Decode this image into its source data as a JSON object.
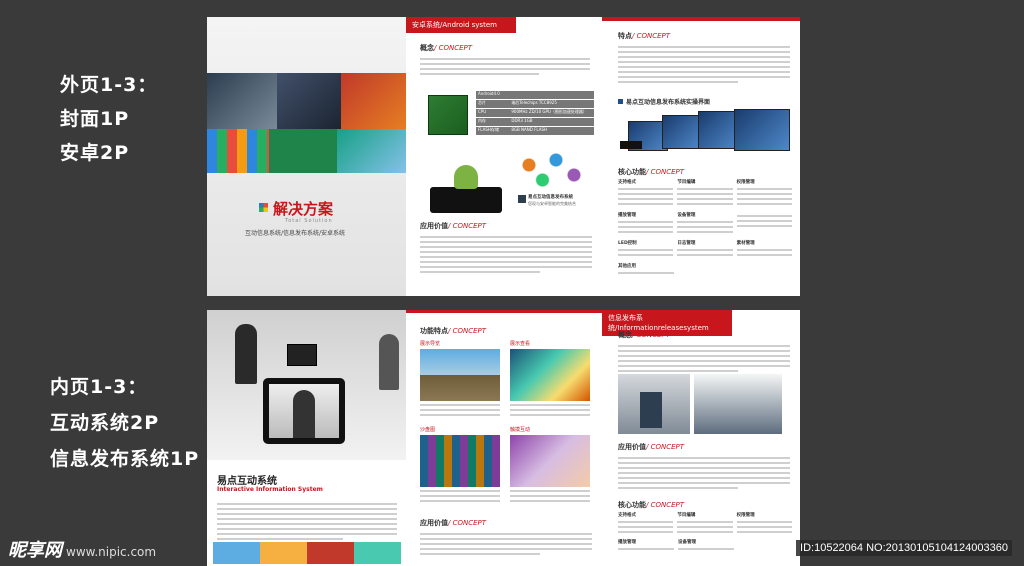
{
  "left_labels": {
    "outer_line1": "外页1-3：",
    "outer_line2": "封面1P",
    "outer_line3": "安卓2P",
    "inner_line1": "内页1-3：",
    "inner_line2": "互动系统2P",
    "inner_line3": "信息发布系统1P"
  },
  "cover": {
    "title": "解决方案",
    "subtitle_en": "Total Solution",
    "subtitle_cn": "互动信息系统/信息发布系统/安卓系统"
  },
  "android_page": {
    "header": "安卓系统",
    "header_en": "/Android system",
    "concept_cn": "概念",
    "concept_en": "/ CONCEPT",
    "value_cn": "应用价值",
    "value_en": "/ CONCEPT",
    "brand_line1": "易点互动信息发布系统",
    "brand_line2": "您现与安卓智能的完美结合",
    "specs": [
      [
        "Android4.0",
        ""
      ],
      [
        "芯片",
        "瑞芯Telechips TCC8925"
      ],
      [
        "CPU",
        "900MHz ZD/10 GPU（图形加速处理器）"
      ],
      [
        "内存",
        "DDR3 1GB"
      ],
      [
        "FLASH存储",
        "8GB NAND FLASH"
      ]
    ]
  },
  "android_right": {
    "feature_cn": "特点",
    "feature_en": "/ CONCEPT",
    "screen_title": "易点互动信息发布系统实操界面",
    "core_cn": "核心功能",
    "core_en": "/ CONCEPT",
    "funcs": [
      "支持格式",
      "节目编辑",
      "权限管理",
      "播放管理",
      "设备管理",
      "LED控制",
      "日志管理",
      "素材管理",
      "其他应用"
    ]
  },
  "interactive_page": {
    "title_cn": "易点互动系统",
    "title_en": "Interactive Information System"
  },
  "features_page": {
    "feature_cn": "功能特点",
    "feature_en": "/ CONCEPT",
    "value_cn": "应用价值",
    "value_en": "/ CONCEPT",
    "boxes": [
      "展示导览",
      "展示查看",
      "沙盘图",
      "触摸互动"
    ]
  },
  "info_page": {
    "header": "信息发布系统",
    "header_en": "/Informationreleasesystem",
    "concept_cn": "概念",
    "concept_en": "/ CONCEPT",
    "value_cn": "应用价值",
    "value_en": "/ CONCEPT",
    "core_cn": "核心功能",
    "core_en": "/ CONCEPT",
    "funcs": [
      "支持格式",
      "节目编辑",
      "权限管理",
      "播放管理",
      "设备管理"
    ]
  },
  "watermark": {
    "brand": "昵享网",
    "url": "www.nipic.com",
    "id_text": "ID:10522064 NO:20130105104124003360"
  },
  "colors": {
    "accent": "#c8161d",
    "background": "#3a3a3a"
  }
}
